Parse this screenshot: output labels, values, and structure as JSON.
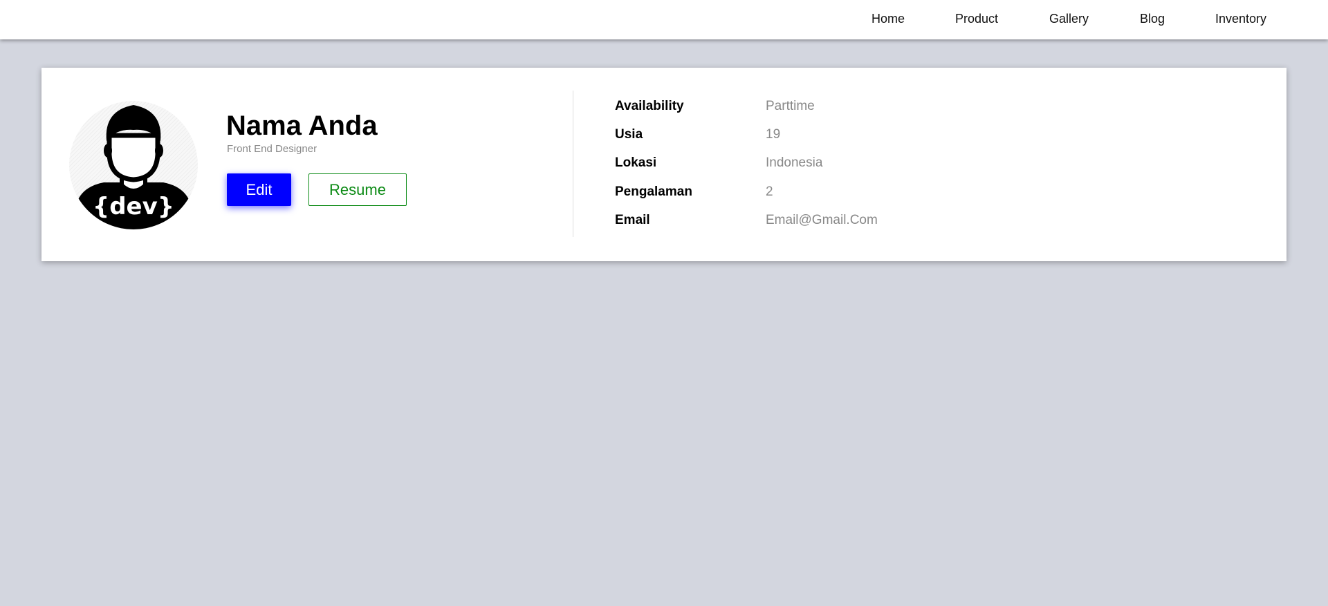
{
  "nav": {
    "items": [
      {
        "label": "Home"
      },
      {
        "label": "Product"
      },
      {
        "label": "Gallery"
      },
      {
        "label": "Blog"
      },
      {
        "label": "Inventory"
      }
    ]
  },
  "profile": {
    "avatar_icon": "developer-avatar-icon",
    "avatar_text": "{dev}",
    "name": "Nama Anda",
    "role": "Front End Designer",
    "edit_label": "Edit",
    "resume_label": "Resume"
  },
  "details": [
    {
      "label": "Availability",
      "value": "Parttime"
    },
    {
      "label": "Usia",
      "value": "19"
    },
    {
      "label": "Lokasi",
      "value": "Indonesia"
    },
    {
      "label": "Pengalaman",
      "value": "2"
    },
    {
      "label": "Email",
      "value": "Email@Gmail.Com"
    }
  ],
  "colors": {
    "background": "#d3d6df",
    "edit_button": "#0000ff",
    "resume_button": "#0b8a14",
    "muted_text": "#888888"
  }
}
